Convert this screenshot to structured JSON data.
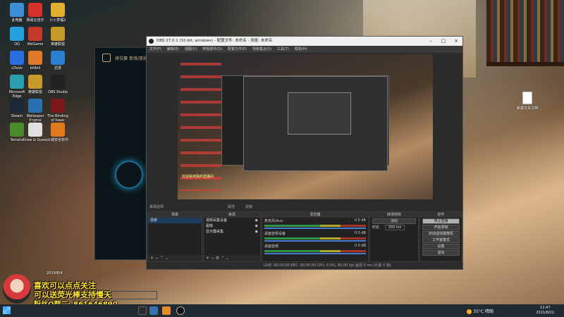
{
  "desktop": {
    "icons": [
      {
        "label": "此电脑",
        "color": "#3b8fd9"
      },
      {
        "label": "网易云音乐",
        "color": "#d6302b"
      },
      {
        "label": "小小梦魇2",
        "color": "#e0b030"
      },
      {
        "label": "QQ",
        "color": "#2a9fe0"
      },
      {
        "label": "WeGame",
        "color": "#c43a2a"
      },
      {
        "label": "英雄联盟",
        "color": "#c79a2a"
      },
      {
        "label": "uTools",
        "color": "#2a6fe0"
      },
      {
        "label": "bilibili",
        "color": "#e07a2a"
      },
      {
        "label": "迅雷",
        "color": "#2a7fd0"
      },
      {
        "label": "Microsoft Edge",
        "color": "#2a9fb0"
      },
      {
        "label": "英雄联盟",
        "color": "#c79a2a"
      },
      {
        "label": "OBS Studio",
        "color": "#222222"
      },
      {
        "label": "Steam",
        "color": "#1b2838"
      },
      {
        "label": "Wallpaper Engine",
        "color": "#2a6fb0"
      },
      {
        "label": "The Binding of Isaac",
        "color": "#7a1a1a"
      },
      {
        "label": "Terraria",
        "color": "#4a8a2a"
      },
      {
        "label": "Draw & Guess",
        "color": "#e0e0e0"
      },
      {
        "label": "火绒安全软件",
        "color": "#e07a1a"
      }
    ],
    "new_doc_label": "新建文本文档"
  },
  "lol_client": {
    "title": "排位赛 单排/双排"
  },
  "obs": {
    "title": "OBS 27.0.1 (32-bit, windows) - 配置文件: 未命名 - 场景: 未命名",
    "menu": [
      "文件(F)",
      "编辑(E)",
      "视图(V)",
      "停靠部件(D)",
      "配置文件(P)",
      "场景集合(S)",
      "工具(T)",
      "帮助(H)"
    ],
    "preview_overlay": "欢迎来到我的直播间",
    "status_row": {
      "left": "来源选择",
      "mid": "属性",
      "right": "滤镜"
    },
    "docks": {
      "scenes": {
        "title": "场景",
        "items": [
          "场景"
        ]
      },
      "sources": {
        "title": "来源",
        "items": [
          "视频采集设备",
          "图像",
          "显示器采集"
        ]
      },
      "mixer": {
        "title": "混音器",
        "channels": [
          {
            "name": "麦克风/Aux",
            "level": "0.0 dB"
          },
          {
            "name": "桌面音频设备",
            "level": "0.0 dB"
          },
          {
            "name": "桌面音频",
            "level": "0.0 dB"
          }
        ]
      },
      "transitions": {
        "title": "转场特效",
        "type": "淡出",
        "duration_label": "时长",
        "duration": "300 ms"
      },
      "controls": {
        "title": "控件",
        "buttons": [
          "停止直播",
          "开始录制",
          "启动虚拟摄像机",
          "工作室模式",
          "设置",
          "退出"
        ]
      }
    },
    "statusbar": "LIVE: 00:00:00   REC: 00:00:00   CPU: 0.0%, 60.00 fps   延迟 0 ms (已丢 0 帧)"
  },
  "overlay": {
    "line1": "喜欢可以点点关注",
    "line2": "可以送荧光棒支持慢天",
    "line3": "粉丝Q群二: 861646890",
    "small": "2019/8/4"
  },
  "taskbar": {
    "weather": "35°C 晴朗",
    "time": "12:47",
    "date": "2021/8/22"
  }
}
